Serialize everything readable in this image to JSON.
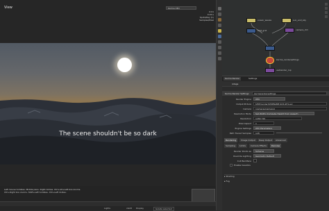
{
  "viewer": {
    "title": "View",
    "header_badge": "Karma XPU",
    "stats": [
      "0:01",
      "0.00 s",
      "Spots/Ray (1)",
      "Samples/Pixel"
    ],
    "caption": "The scene shouldn't be so dark",
    "status_lines": [
      "Left mouse tumbles. Middle pans. Right dollies. Ctrl+Alt+Left box-zooms.",
      "Ctrl+Right box zooms. Shift+Left tumbles. Ctrl+Left dollies."
    ],
    "footer": [
      "Lights",
      "xGLB",
      "Display",
      "Isolate selected"
    ]
  },
  "network": {
    "nodes": [
      {
        "label": "ocean_waves"
      },
      {
        "label": "sun_and_sky"
      },
      {
        "label": "mat_grid"
      },
      {
        "label": "camera_ctrl"
      },
      {
        "label": "karma_rendersettings"
      },
      {
        "label": "usdrender_rop"
      }
    ]
  },
  "params": {
    "tabs": [
      "Karma Render",
      "Settings"
    ],
    "path": "/stage",
    "node_type": "Karma Render Settings",
    "node_name": "karmarendersettings",
    "rows": [
      {
        "label": "Render Engine",
        "value": "XPU"
      },
      {
        "label": "Output Picture",
        "value": "$HIP/render/$HIPNAME.$OS.$F4.exr"
      },
      {
        "label": "Camera",
        "value": "/cameras/camera1"
      },
      {
        "label": "Resolution Mode",
        "value": "Set Width (Compute Height from Aspect)"
      },
      {
        "label": "Resolution",
        "value": "1280    720"
      },
      {
        "label": "Pixel Aspect",
        "value": "1"
      },
      {
        "label": "Engine Settings",
        "value": "XPU Parameters"
      },
      {
        "label": "Path Traced Samples",
        "value": "128"
      }
    ],
    "tab_row_1": [
      "Rendering",
      "Image Output",
      "Deep Output",
      "Advanced"
    ],
    "tab_row_2": [
      "Sampling",
      "Limits",
      "Camera Effects",
      "Denoise"
    ],
    "lower_rows": [
      {
        "label": "Render Points as",
        "value": "Spheres"
      },
      {
        "label": "Override Lighting",
        "value": "Geometry Default"
      },
      {
        "label": "Cull Backface",
        "value": ""
      }
    ],
    "enable_label": "Enable Caustics",
    "sections": [
      "Shading",
      "Fog"
    ]
  },
  "colors": {
    "node_blue": "#3b5a8c",
    "node_yellow": "#c9bd6a",
    "node_purple": "#7b4a9c",
    "node_render": "#c4463a",
    "selected_outline": "#ffcc33",
    "panel_bg": "#2b2b2b"
  }
}
